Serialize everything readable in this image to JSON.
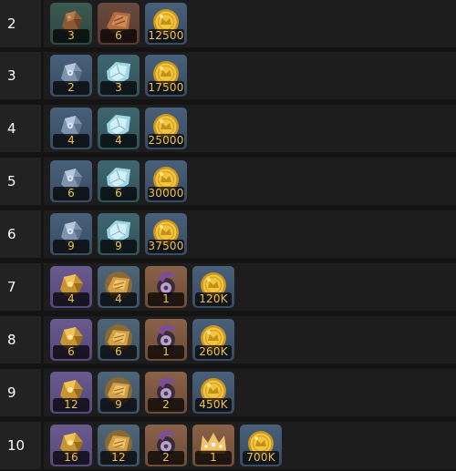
{
  "rows": [
    {
      "level": "2",
      "items": [
        {
          "icon": "bronze-ore-icon",
          "qty": "3",
          "bg": "green"
        },
        {
          "icon": "bronze-ingot-icon",
          "qty": "6",
          "bg": "brown"
        },
        {
          "icon": "gold-coin-icon",
          "qty": "12500",
          "bg": "blue"
        }
      ]
    },
    {
      "level": "3",
      "items": [
        {
          "icon": "silver-ore-icon",
          "qty": "2",
          "bg": "blue"
        },
        {
          "icon": "crystal-icon",
          "qty": "3",
          "bg": "teal"
        },
        {
          "icon": "gold-coin-icon",
          "qty": "17500",
          "bg": "blue"
        }
      ]
    },
    {
      "level": "4",
      "items": [
        {
          "icon": "silver-ore-icon",
          "qty": "4",
          "bg": "blue"
        },
        {
          "icon": "crystal-icon",
          "qty": "4",
          "bg": "teal"
        },
        {
          "icon": "gold-coin-icon",
          "qty": "25000",
          "bg": "blue"
        }
      ]
    },
    {
      "level": "5",
      "items": [
        {
          "icon": "silver-ore-icon",
          "qty": "6",
          "bg": "blue"
        },
        {
          "icon": "crystal-icon",
          "qty": "6",
          "bg": "teal"
        },
        {
          "icon": "gold-coin-icon",
          "qty": "30000",
          "bg": "blue"
        }
      ]
    },
    {
      "level": "6",
      "items": [
        {
          "icon": "silver-ore-icon",
          "qty": "9",
          "bg": "blue"
        },
        {
          "icon": "crystal-icon",
          "qty": "9",
          "bg": "teal"
        },
        {
          "icon": "gold-coin-icon",
          "qty": "37500",
          "bg": "blue"
        }
      ]
    },
    {
      "level": "7",
      "items": [
        {
          "icon": "gold-ore-icon",
          "qty": "4",
          "bg": "purple"
        },
        {
          "icon": "gold-ingot-icon",
          "qty": "4",
          "bg": "slate"
        },
        {
          "icon": "horn-relic-icon",
          "qty": "1",
          "bg": "tan"
        },
        {
          "icon": "gold-coin-icon",
          "qty": "120K",
          "bg": "blue"
        }
      ]
    },
    {
      "level": "8",
      "items": [
        {
          "icon": "gold-ore-icon",
          "qty": "6",
          "bg": "purple"
        },
        {
          "icon": "gold-ingot-icon",
          "qty": "6",
          "bg": "slate"
        },
        {
          "icon": "horn-relic-icon",
          "qty": "1",
          "bg": "tan"
        },
        {
          "icon": "gold-coin-icon",
          "qty": "260K",
          "bg": "blue"
        }
      ]
    },
    {
      "level": "9",
      "items": [
        {
          "icon": "gold-ore-icon",
          "qty": "12",
          "bg": "purple"
        },
        {
          "icon": "gold-ingot-icon",
          "qty": "9",
          "bg": "slate"
        },
        {
          "icon": "horn-relic-icon",
          "qty": "2",
          "bg": "tan"
        },
        {
          "icon": "gold-coin-icon",
          "qty": "450K",
          "bg": "blue"
        }
      ]
    },
    {
      "level": "10",
      "items": [
        {
          "icon": "gold-ore-icon",
          "qty": "16",
          "bg": "purple"
        },
        {
          "icon": "gold-ingot-icon",
          "qty": "12",
          "bg": "slate"
        },
        {
          "icon": "horn-relic-icon",
          "qty": "2",
          "bg": "tan"
        },
        {
          "icon": "crown-icon",
          "qty": "1",
          "bg": "tan"
        },
        {
          "icon": "gold-coin-icon",
          "qty": "700K",
          "bg": "blue"
        }
      ]
    }
  ],
  "colors": {
    "quantity_text": "#f0c048",
    "level_cell_bg": "#222222",
    "items_cell_bg": "#1d1d1d"
  }
}
